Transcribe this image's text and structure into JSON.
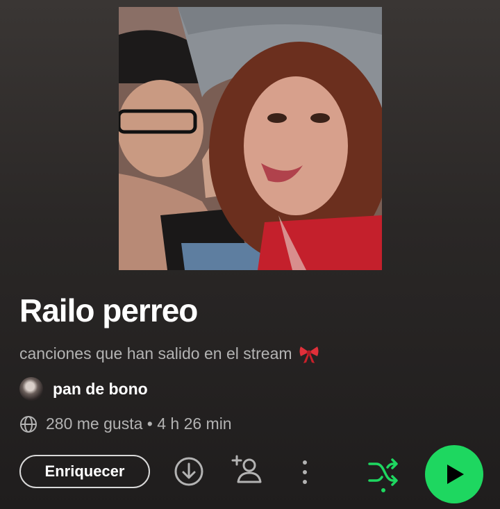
{
  "playlist": {
    "title": "Railo perreo",
    "description": "canciones que han salido en el stream",
    "description_emoji": "bow-emoji"
  },
  "owner": {
    "name": "pan de bono"
  },
  "meta": {
    "text": "280 me gusta • 4 h 26 min"
  },
  "actions": {
    "enrich_label": "Enriquecer",
    "download_icon": "download-circle-icon",
    "add_user_icon": "add-collaborator-icon",
    "more_icon": "more-options-icon",
    "shuffle_icon": "shuffle-icon",
    "play_icon": "play-icon"
  },
  "colors": {
    "accent": "#1ed760",
    "text_secondary": "#b3b3b3",
    "background_top": "#3a3634",
    "background_bottom": "#1f1d1d"
  }
}
